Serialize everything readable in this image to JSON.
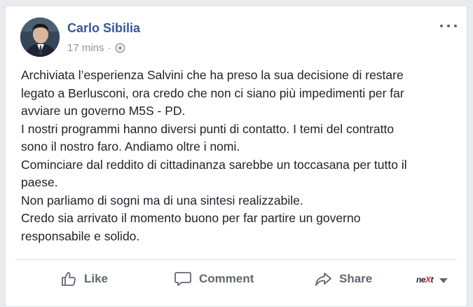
{
  "post": {
    "author": "Carlo Sibilia",
    "timestamp": "17 mins",
    "separator": "·",
    "privacy_icon": "globe-icon",
    "menu_icon": "more-options-icon",
    "body_lines": [
      "Archiviata l’esperienza Salvini che ha preso la sua decisione di restare",
      "legato a Berlusconi, ora credo che non ci siano più impedimenti per far",
      "avviare un governo M5S - PD.",
      "I nostri programmi hanno diversi punti di contatto. I temi del contratto",
      "sono il nostro faro. Andiamo oltre i nomi.",
      "Cominciare dal reddito di cittadinanza sarebbe un toccasana per tutto il",
      "paese.",
      "Non parliamo di sogni ma di una sintesi realizzabile.",
      "Credo sia arrivato il momento buono per far partire un governo",
      "responsabile e solido."
    ]
  },
  "actions": {
    "like_label": "Like",
    "comment_label": "Comment",
    "share_label": "Share",
    "brand_prefix": "ne",
    "brand_x": "X",
    "brand_suffix": "t"
  },
  "colors": {
    "author_link": "#365899",
    "meta_gray": "#90949c",
    "action_gray": "#606770",
    "text": "#1d2129"
  }
}
